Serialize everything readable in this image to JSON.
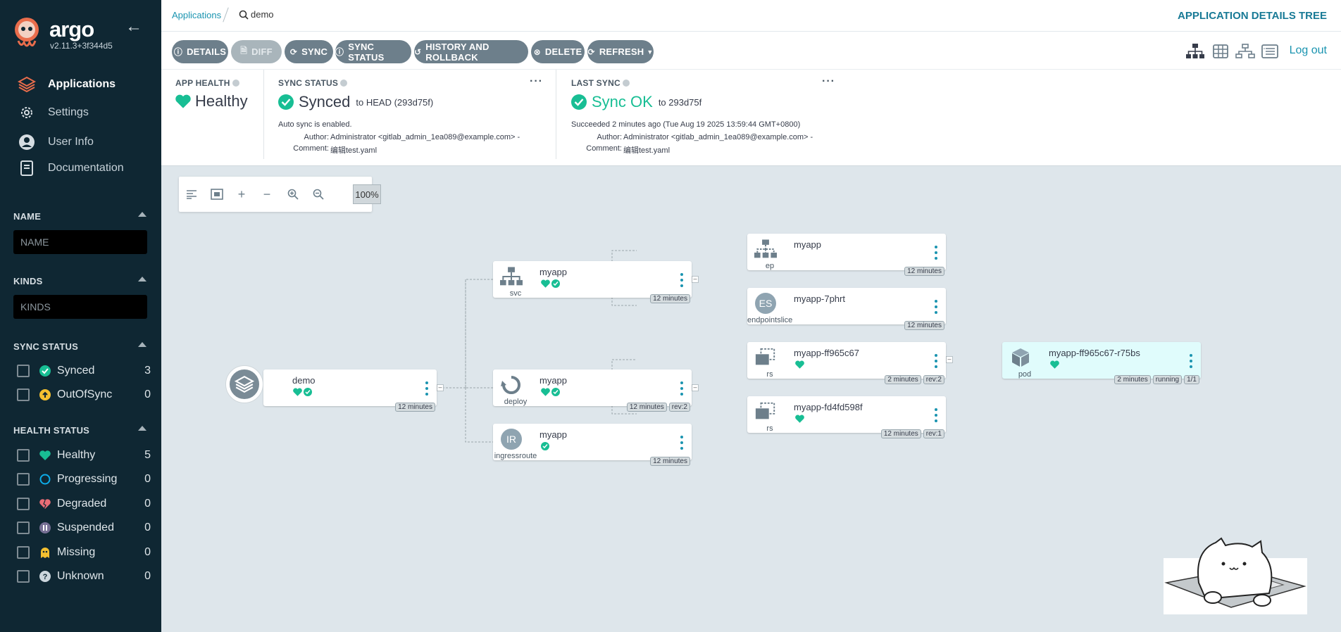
{
  "sidebar": {
    "brand": "argo",
    "version": "v2.11.3+3f344d5",
    "nav": [
      {
        "label": "Applications",
        "icon": "layers-icon"
      },
      {
        "label": "Settings",
        "icon": "gear-icon"
      },
      {
        "label": "User Info",
        "icon": "user-icon"
      },
      {
        "label": "Documentation",
        "icon": "book-icon"
      }
    ],
    "name_filter": {
      "title": "NAME",
      "placeholder": "NAME"
    },
    "kinds_filter": {
      "title": "KINDS",
      "placeholder": "KINDS"
    },
    "sync_status": {
      "title": "SYNC STATUS",
      "items": [
        {
          "label": "Synced",
          "count": "3"
        },
        {
          "label": "OutOfSync",
          "count": "0"
        }
      ]
    },
    "health_status": {
      "title": "HEALTH STATUS",
      "items": [
        {
          "label": "Healthy",
          "count": "5"
        },
        {
          "label": "Progressing",
          "count": "0"
        },
        {
          "label": "Degraded",
          "count": "0"
        },
        {
          "label": "Suspended",
          "count": "0"
        },
        {
          "label": "Missing",
          "count": "0"
        },
        {
          "label": "Unknown",
          "count": "0"
        }
      ]
    }
  },
  "topbar": {
    "breadcrumb": "Applications",
    "search": "demo",
    "title": "APPLICATION DETAILS TREE",
    "logout": "Log out"
  },
  "toolbar": {
    "buttons": [
      {
        "label": "DETAILS"
      },
      {
        "label": "DIFF"
      },
      {
        "label": "SYNC"
      },
      {
        "label": "SYNC STATUS"
      },
      {
        "label": "HISTORY AND ROLLBACK"
      },
      {
        "label": "DELETE"
      },
      {
        "label": "REFRESH"
      }
    ]
  },
  "status": {
    "app_health": {
      "title": "APP HEALTH",
      "value": "Healthy"
    },
    "sync_status": {
      "title": "SYNC STATUS",
      "value": "Synced",
      "target": "to HEAD (293d75f)",
      "auto": "Auto sync is enabled.",
      "author_label": "Author:",
      "author": "Administrator <gitlab_admin_1ea089@example.com> -",
      "comment_label": "Comment:",
      "comment": "编辑test.yaml"
    },
    "last_sync": {
      "title": "LAST SYNC",
      "value": "Sync OK",
      "target": "to 293d75f",
      "succeeded": "Succeeded 2 minutes ago (Tue Aug 19 2025 13:59:44 GMT+0800)",
      "author_label": "Author:",
      "author": "Administrator <gitlab_admin_1ea089@example.com> -",
      "comment_label": "Comment:",
      "comment": "编辑test.yaml"
    }
  },
  "graph": {
    "zoom": "100%",
    "nodes": {
      "demo": {
        "name": "demo",
        "age": "12 minutes"
      },
      "svc": {
        "name": "myapp",
        "kind": "svc",
        "age": "12 minutes"
      },
      "deploy": {
        "name": "myapp",
        "kind": "deploy",
        "age": "12 minutes",
        "rev": "rev:2"
      },
      "ingress": {
        "name": "myapp",
        "kind": "ingressroute",
        "badge": "IR",
        "age": "12 minutes"
      },
      "ep": {
        "name": "myapp",
        "kind": "ep",
        "age": "12 minutes"
      },
      "eps": {
        "name": "myapp-7phrt",
        "kind": "endpointslice",
        "badge": "ES",
        "age": "12 minutes"
      },
      "rs1": {
        "name": "myapp-ff965c67",
        "kind": "rs",
        "age": "2 minutes",
        "rev": "rev:2"
      },
      "rs2": {
        "name": "myapp-fd4fd598f",
        "kind": "rs",
        "age": "12 minutes",
        "rev": "rev:1"
      },
      "pod": {
        "name": "myapp-ff965c67-r75bs",
        "kind": "pod",
        "age": "2 minutes",
        "state": "running",
        "ready": "1/1"
      }
    }
  },
  "colors": {
    "sidebar": "#0f2733",
    "accent": "#1a94b0",
    "healthy": "#18be94",
    "button": "#6d7f8b"
  }
}
